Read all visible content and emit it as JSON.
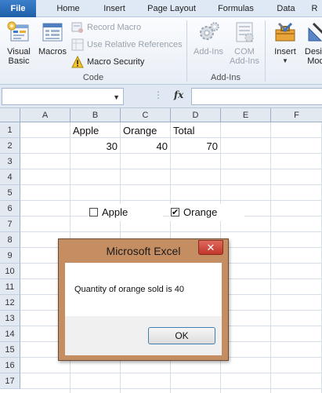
{
  "ribbon": {
    "tabs": [
      "File",
      "Home",
      "Insert",
      "Page Layout",
      "Formulas",
      "Data",
      "R"
    ],
    "active_tab": "Developer",
    "groups": {
      "code": {
        "label": "Code",
        "visual_basic": "Visual Basic",
        "macros": "Macros",
        "record_macro": "Record Macro",
        "use_relative": "Use Relative References",
        "macro_security": "Macro Security"
      },
      "addins": {
        "label": "Add-Ins",
        "addins": "Add-Ins",
        "com_addins": "COM Add-Ins"
      },
      "controls": {
        "insert": "Insert",
        "design_mode": "Design Mode"
      }
    }
  },
  "formula_bar": {
    "name_box": "",
    "fx": "fx",
    "value": ""
  },
  "sheet": {
    "columns": [
      "A",
      "B",
      "C",
      "D",
      "E",
      "F"
    ],
    "rows": [
      "1",
      "2",
      "3",
      "4",
      "5",
      "6",
      "7",
      "8",
      "9",
      "10",
      "11",
      "12",
      "13",
      "14",
      "15",
      "16",
      "17"
    ],
    "cells": {
      "B1": "Apple",
      "C1": "Orange",
      "D1": "Total",
      "B2": "30",
      "C2": "40",
      "D2": "70"
    },
    "checkboxes": [
      {
        "label": "Apple",
        "checked": false
      },
      {
        "label": "Orange",
        "checked": true
      }
    ]
  },
  "dialog": {
    "title": "Microsoft Excel",
    "close": "✕",
    "message": "Quantity of orange sold is 40",
    "ok": "OK"
  }
}
